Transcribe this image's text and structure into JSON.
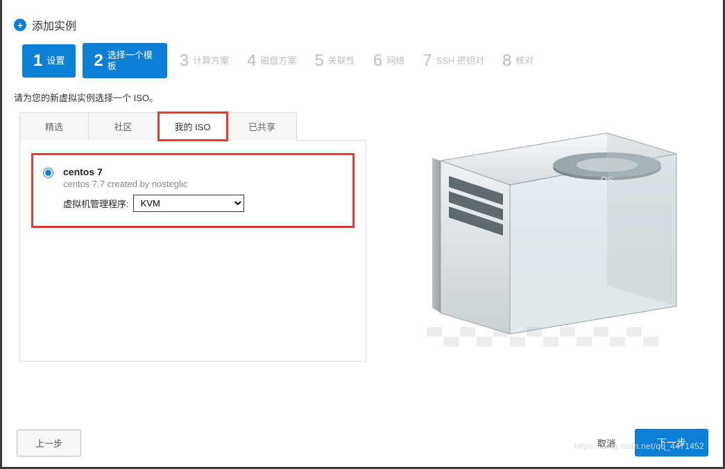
{
  "header": {
    "title": "添加实例",
    "icon": "plus-circle"
  },
  "steps": [
    {
      "num": "1",
      "label": "设置",
      "active": true
    },
    {
      "num": "2",
      "label": "选择一个模板",
      "active": true
    },
    {
      "num": "3",
      "label": "计算方案",
      "active": false
    },
    {
      "num": "4",
      "label": "磁盘方案",
      "active": false
    },
    {
      "num": "5",
      "label": "关联性",
      "active": false
    },
    {
      "num": "6",
      "label": "网络",
      "active": false
    },
    {
      "num": "7",
      "label": "SSH 密钥对",
      "active": false
    },
    {
      "num": "8",
      "label": "核对",
      "active": false
    }
  ],
  "instruction": "请为您的新虚拟实例选择一个 ISO。",
  "tabs": {
    "featured": "精选",
    "community": "社区",
    "my_iso": "我的 ISO",
    "shared": "已共享",
    "active": "my_iso"
  },
  "iso": {
    "name": "centos 7",
    "description": "centos 7.7 created by nosteglic",
    "hypervisor_label": "虚拟机管理程序:",
    "hypervisor_value": "KVM",
    "selected": true
  },
  "illustration": {
    "os_badge": "OS"
  },
  "footer": {
    "prev": "上一步",
    "cancel": "取消",
    "next": "下一步"
  },
  "watermark": "https://blog.csdn.net/qq_4471452"
}
